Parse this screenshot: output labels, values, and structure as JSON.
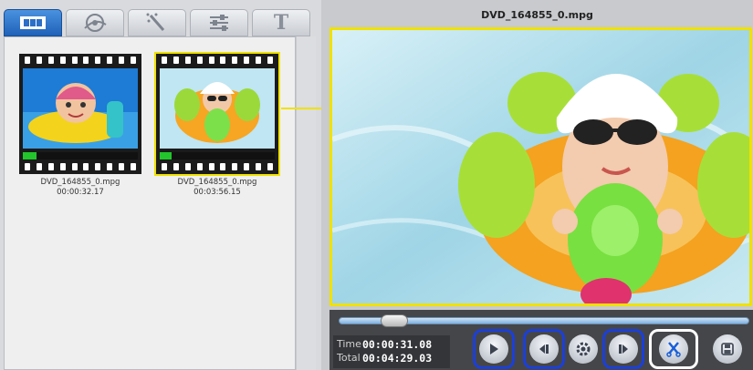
{
  "tabs": [
    {
      "name": "clips",
      "icon": "filmstrip-icon",
      "active": true
    },
    {
      "name": "effects",
      "icon": "film-reel-icon",
      "active": false
    },
    {
      "name": "magic",
      "icon": "magic-wand-icon",
      "active": false
    },
    {
      "name": "adjust",
      "icon": "sliders-icon",
      "active": false
    },
    {
      "name": "text",
      "icon": "text-icon",
      "label": "T",
      "active": false
    }
  ],
  "clips": [
    {
      "name": "DVD_164855_0.mpg",
      "duration": "00:00:32.17",
      "progress": 0.12,
      "selected": false
    },
    {
      "name": "DVD_164855_0.mpg",
      "duration": "00:03:56.15",
      "progress": 0.1,
      "selected": true
    }
  ],
  "preview": {
    "title": "DVD_164855_0.mpg"
  },
  "playback": {
    "seek_position": 0.13,
    "time_label": "Time",
    "time_value": "00:00:31.08",
    "total_label": "Total",
    "total_value": "00:04:29.03"
  },
  "buttons": [
    {
      "name": "play-button",
      "icon": "play-icon"
    },
    {
      "name": "previous-frame-button",
      "icon": "step-back-icon"
    },
    {
      "name": "settings-button",
      "icon": "gear-icon"
    },
    {
      "name": "next-frame-button",
      "icon": "step-forward-icon"
    },
    {
      "name": "cut-button",
      "icon": "scissors-icon"
    },
    {
      "name": "save-button",
      "icon": "save-icon"
    }
  ],
  "colors": {
    "selection": "#f0e100",
    "tab_active": "#2f76cf",
    "progress": "#22c52b",
    "highlight_ring": "#1b3fd8"
  }
}
